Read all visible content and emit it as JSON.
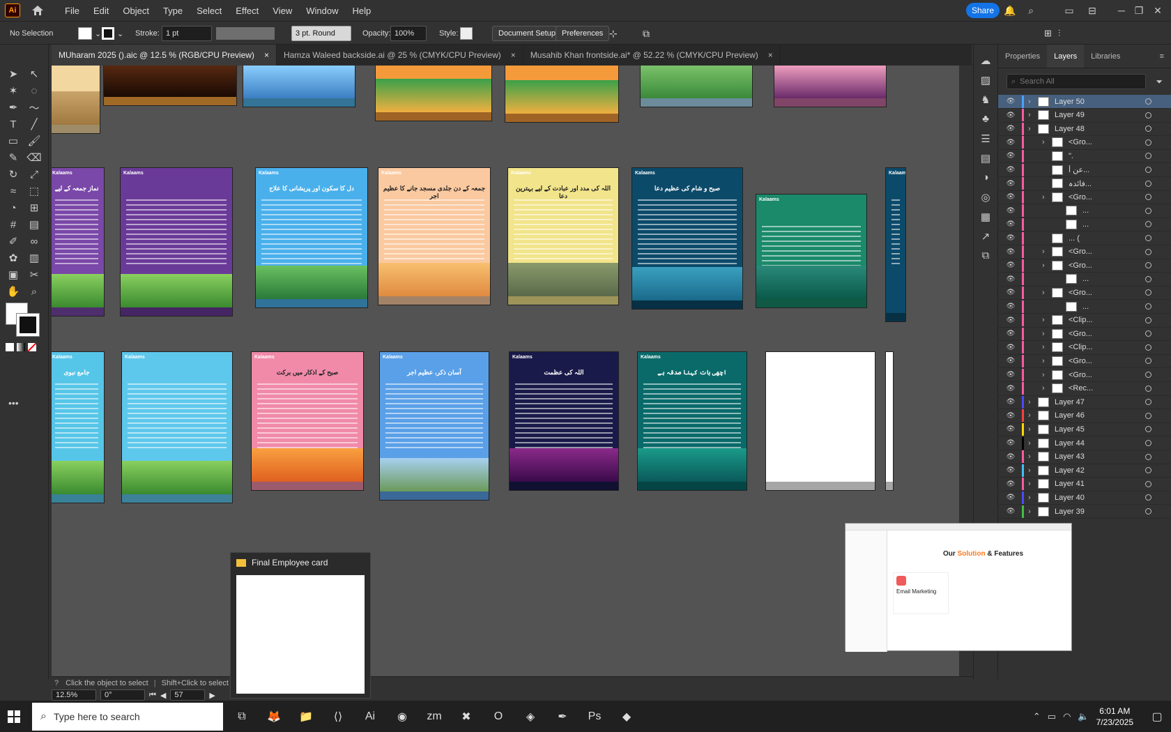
{
  "app": {
    "logo": "Ai"
  },
  "menu": [
    "File",
    "Edit",
    "Object",
    "Type",
    "Select",
    "Effect",
    "View",
    "Window",
    "Help"
  ],
  "topbar": {
    "share": "Share"
  },
  "control": {
    "selection": "No Selection",
    "stroke_label": "Stroke:",
    "stroke_value": "1 pt",
    "brush": "3 pt. Round",
    "opacity_label": "Opacity:",
    "opacity_value": "100%",
    "style_label": "Style:",
    "doc_setup": "Document Setup",
    "preferences": "Preferences"
  },
  "tabs": [
    {
      "label": "MUharam 2025 ().aic @ 12.5 % (RGB/CPU Preview)"
    },
    {
      "label": "Hamza Waleed backside.ai @ 25 % (CMYK/CPU Preview)"
    },
    {
      "label": "Musahib Khan  frontside.ai* @ 52.22 % (CMYK/CPU Preview)"
    }
  ],
  "panel": {
    "tabs": [
      "Properties",
      "Layers",
      "Libraries"
    ],
    "search_placeholder": "Search All",
    "rows": [
      {
        "name": "Layer 50",
        "color": "#4aa3ff",
        "sel": true
      },
      {
        "name": "Layer 49",
        "color": "#ff5aa0"
      },
      {
        "name": "Layer 48",
        "color": "#ff5aa0"
      },
      {
        "name": "<Gro...",
        "color": "#ff5aa0"
      },
      {
        "name": "\".",
        "color": "#ff5aa0"
      },
      {
        "name": "عن أ...",
        "color": "#ff5aa0"
      },
      {
        "name": "فائدہ...",
        "color": "#ff5aa0"
      },
      {
        "name": "<Gro...",
        "color": "#ff5aa0"
      },
      {
        "name": "...",
        "color": "#ff5aa0"
      },
      {
        "name": "...",
        "color": "#ff5aa0"
      },
      {
        "name": "... (",
        "color": "#ff5aa0"
      },
      {
        "name": "<Gro...",
        "color": "#ff5aa0"
      },
      {
        "name": "<Gro...",
        "color": "#ff5aa0"
      },
      {
        "name": "...",
        "color": "#ff5aa0"
      },
      {
        "name": "<Gro...",
        "color": "#ff5aa0"
      },
      {
        "name": "...",
        "color": "#ff5aa0"
      },
      {
        "name": "<Clip...",
        "color": "#ff5aa0"
      },
      {
        "name": "<Gro...",
        "color": "#ff5aa0"
      },
      {
        "name": "<Clip...",
        "color": "#ff5aa0"
      },
      {
        "name": "<Gro...",
        "color": "#ff5aa0"
      },
      {
        "name": "<Gro...",
        "color": "#ff5aa0"
      },
      {
        "name": "<Rec...",
        "color": "#ff5aa0"
      },
      {
        "name": "Layer 47",
        "color": "#4a4aff"
      },
      {
        "name": "Layer 46",
        "color": "#ff4040"
      },
      {
        "name": "Layer 45",
        "color": "#ffd700"
      },
      {
        "name": "Layer 44",
        "color": "#000000"
      },
      {
        "name": "Layer 43",
        "color": "#ff5aa0"
      },
      {
        "name": "Layer 42",
        "color": "#40c0ff"
      },
      {
        "name": "Layer 41",
        "color": "#ff5aa0"
      },
      {
        "name": "Layer 40",
        "color": "#4a4aff"
      },
      {
        "name": "Layer 39",
        "color": "#40c040"
      }
    ]
  },
  "status": {
    "hint": "Click the object to select",
    "hint2": "Shift+Click to select mult",
    "zoom": "12.5%",
    "rotation": "0°",
    "artboard": "57"
  },
  "popup": {
    "title": "Final Employee card"
  },
  "browser_preview": {
    "heading_a": "Our ",
    "heading_b": "Solution",
    "heading_c": " & Features",
    "card": "Email Marketing"
  },
  "taskbar": {
    "search_placeholder": "Type here to search",
    "time": "6:01 AM",
    "date": "7/23/2025"
  },
  "cards": {
    "kalaams": "Kalaams",
    "row2_titles": [
      "نماز جمعہ کے لیے",
      "",
      "دل کا سکون اور پریشانی کا علاج",
      "جمعہ کے دن جلدی مسجد جانے کا عظیم اجر",
      "اللہ کی مدد اور عبادت کے لیے بہترین دعا",
      "صبح و شام کی عظیم دعا",
      ""
    ],
    "row3_titles": [
      "جامع نبوی",
      "",
      "صبح کے اذکار میں برکت",
      "آسان ذکر، عظیم اجر",
      "اللہ کی عظمت",
      "اچھی بات کہنا صدقہ ہے",
      ""
    ]
  }
}
